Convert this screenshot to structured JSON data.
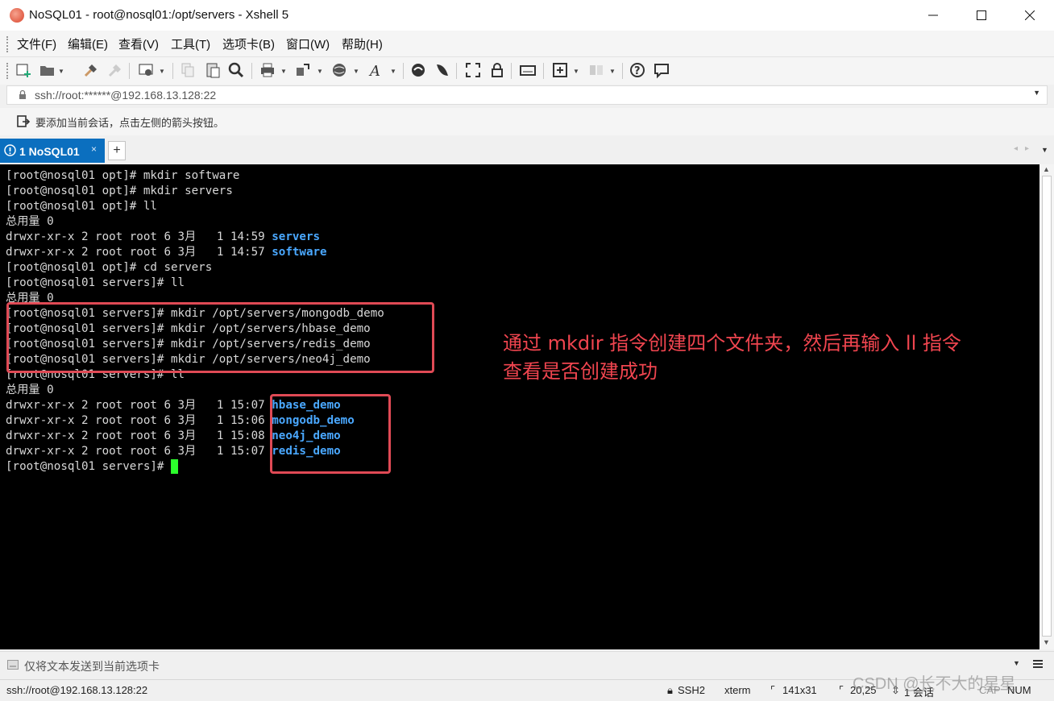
{
  "window": {
    "title": "NoSQL01 - root@nosql01:/opt/servers - Xshell 5",
    "controls": [
      "minimize",
      "maximize",
      "close"
    ]
  },
  "menu": [
    {
      "label": "文件(F)"
    },
    {
      "label": "编辑(E)"
    },
    {
      "label": "查看(V)"
    },
    {
      "label": "工具(T)"
    },
    {
      "label": "选项卡(B)"
    },
    {
      "label": "窗口(W)"
    },
    {
      "label": "帮助(H)"
    }
  ],
  "toolbar": {
    "icons": [
      "new-session-icon",
      "open-folder-icon",
      "connect-icon",
      "disconnect-icon",
      "properties-icon",
      "copy-icon",
      "paste-icon",
      "find-icon",
      "print-icon",
      "transfer-icon",
      "globe-icon",
      "font-icon",
      "xftp-icon",
      "xmanager-icon",
      "fullscreen-icon",
      "lock-icon",
      "keyboard-icon",
      "compose-icon",
      "layout-icon",
      "help-icon",
      "chat-icon"
    ]
  },
  "address": {
    "value": "ssh://root:******@192.168.13.128:22"
  },
  "hint": {
    "text": "要添加当前会话，点击左侧的箭头按钮。"
  },
  "tabs": [
    {
      "label": "1 NoSQL01",
      "close": "×"
    }
  ],
  "tab_add": "+",
  "terminal": {
    "lines": [
      [
        {
          "t": "[root@nosql01 opt]# mkdir software"
        }
      ],
      [
        {
          "t": "[root@nosql01 opt]# mkdir servers"
        }
      ],
      [
        {
          "t": "[root@nosql01 opt]# ll"
        }
      ],
      [
        {
          "t": "总用量 0"
        }
      ],
      [
        {
          "t": "drwxr-xr-x 2 root root 6 3月   1 14:59 "
        },
        {
          "t": "servers",
          "dir": true
        }
      ],
      [
        {
          "t": "drwxr-xr-x 2 root root 6 3月   1 14:57 "
        },
        {
          "t": "software",
          "dir": true
        }
      ],
      [
        {
          "t": "[root@nosql01 opt]# cd servers"
        }
      ],
      [
        {
          "t": "[root@nosql01 servers]# ll"
        }
      ],
      [
        {
          "t": "总用量 0"
        }
      ],
      [
        {
          "t": "[root@nosql01 servers]# mkdir /opt/servers/mongodb_demo"
        }
      ],
      [
        {
          "t": "[root@nosql01 servers]# mkdir /opt/servers/hbase_demo"
        }
      ],
      [
        {
          "t": "[root@nosql01 servers]# mkdir /opt/servers/redis_demo"
        }
      ],
      [
        {
          "t": "[root@nosql01 servers]# mkdir /opt/servers/neo4j_demo"
        }
      ],
      [
        {
          "t": "[root@nosql01 servers]# ll"
        }
      ],
      [
        {
          "t": "总用量 0"
        }
      ],
      [
        {
          "t": "drwxr-xr-x 2 root root 6 3月   1 15:07 "
        },
        {
          "t": "hbase_demo",
          "dir": true
        }
      ],
      [
        {
          "t": "drwxr-xr-x 2 root root 6 3月   1 15:06 "
        },
        {
          "t": "mongodb_demo",
          "dir": true
        }
      ],
      [
        {
          "t": "drwxr-xr-x 2 root root 6 3月   1 15:08 "
        },
        {
          "t": "neo4j_demo",
          "dir": true
        }
      ],
      [
        {
          "t": "drwxr-xr-x 2 root root 6 3月   1 15:07 "
        },
        {
          "t": "redis_demo",
          "dir": true
        }
      ],
      [
        {
          "t": "[root@nosql01 servers]# "
        }
      ]
    ],
    "foreground": "#d8d8d8",
    "directory_color": "#4aa8ff",
    "cursor_color": "#2cff2c"
  },
  "annotation": {
    "line1": "通过 mkdir 指令创建四个文件夹，然后再输入 ll 指令",
    "line2": "查看是否创建成功",
    "color": "#f0454f"
  },
  "sendbar": {
    "text": "仅将文本发送到当前选项卡"
  },
  "status": {
    "connection": "ssh://root@192.168.13.128:22",
    "protocol": "SSH2",
    "terminal_type": "xterm",
    "size": "141x31",
    "cursor_pos": "20,25",
    "sessions": "1 会话",
    "caps": "CAP",
    "num": "NUM"
  },
  "watermark": "CSDN @长不大的星星"
}
